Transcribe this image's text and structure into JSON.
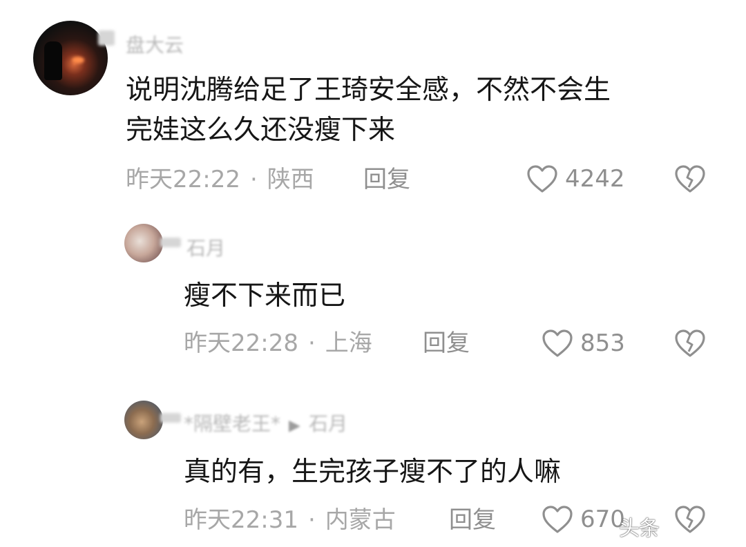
{
  "comments": [
    {
      "username": "盘大云",
      "text_lines": [
        "说明沈腾给足了王琦安全感，不然不会生",
        "完娃这么久还没瘦下来"
      ],
      "time": "昨天22:22",
      "location": "陕西",
      "reply_label": "回复",
      "likes": "4242"
    },
    {
      "username": "石月",
      "text_lines": [
        "瘦不下来而已"
      ],
      "time": "昨天22:28",
      "location": "上海",
      "reply_label": "回复",
      "likes": "853"
    },
    {
      "username": "*隔壁老王*",
      "reply_to": "石月",
      "text_lines": [
        "真的有，生完孩子瘦不了的人嘛"
      ],
      "time": "昨天22:31",
      "location": "内蒙古",
      "reply_label": "回复",
      "likes": "670"
    }
  ],
  "separator": "·",
  "icons": {
    "like": "heart-outline-icon",
    "dislike": "broken-heart-icon",
    "reply_arrow": "triangle-right-icon"
  },
  "colors": {
    "text": "#161616",
    "meta": "#a7a7a7",
    "action": "#8f8f8f"
  },
  "watermark": "头条"
}
